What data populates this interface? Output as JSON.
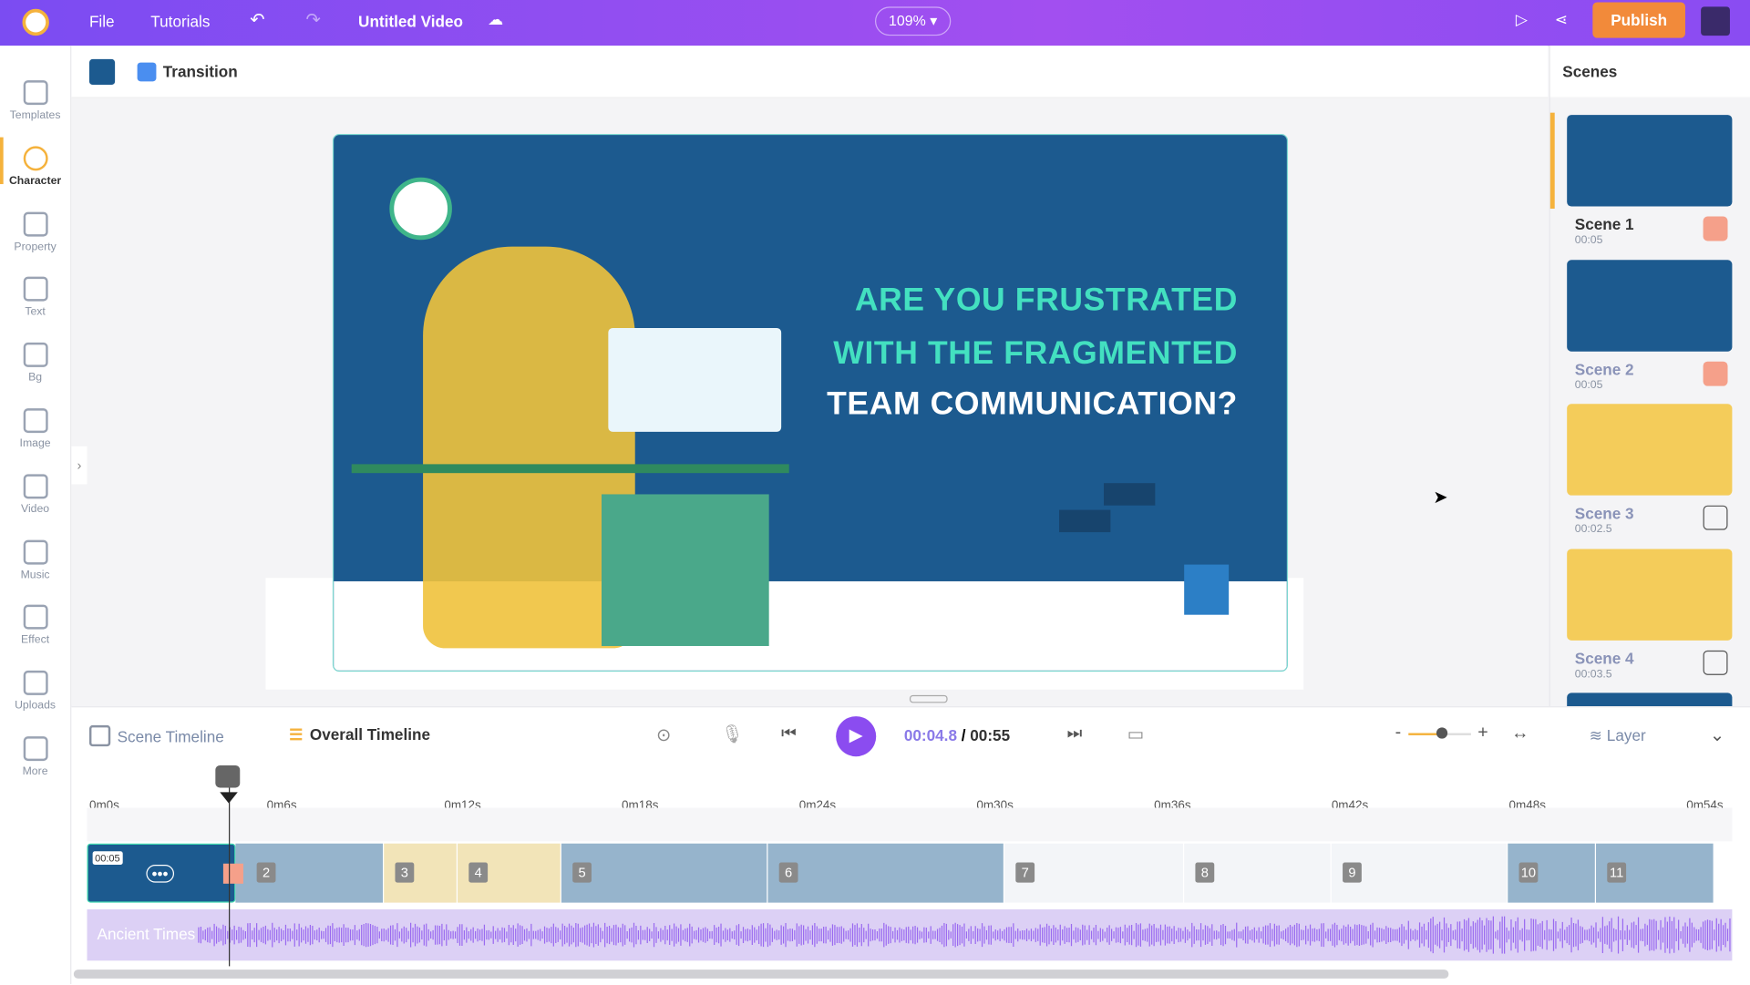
{
  "topbar": {
    "file": "File",
    "tutorials": "Tutorials",
    "title": "Untitled Video",
    "zoom": "109%",
    "publish": "Publish"
  },
  "sidebar": {
    "items": [
      {
        "label": "Templates"
      },
      {
        "label": "Character"
      },
      {
        "label": "Property"
      },
      {
        "label": "Text"
      },
      {
        "label": "Bg"
      },
      {
        "label": "Image"
      },
      {
        "label": "Video"
      },
      {
        "label": "Music"
      },
      {
        "label": "Effect"
      },
      {
        "label": "Uploads"
      },
      {
        "label": "More"
      }
    ],
    "active": "Character"
  },
  "subbar": {
    "transition": "Transition",
    "color": "#1c5a8f"
  },
  "slide": {
    "line1": "ARE YOU FRUSTRATED",
    "line2": "WITH THE FRAGMENTED",
    "line3": "TEAM COMMUNICATION?"
  },
  "scenes": {
    "title": "Scenes",
    "items": [
      {
        "name": "Scene 1",
        "dur": "00:05",
        "color": "#1c5a8f"
      },
      {
        "name": "Scene 2",
        "dur": "00:05",
        "color": "#1c5a8f"
      },
      {
        "name": "Scene 3",
        "dur": "00:02.5",
        "color": "#f4cc5a"
      },
      {
        "name": "Scene 4",
        "dur": "00:03.5",
        "color": "#f4cc5a"
      }
    ]
  },
  "timeline": {
    "scene_tab": "Scene Timeline",
    "overall_tab": "Overall Timeline",
    "current": "00:04.8",
    "sep": "/",
    "total": "00:55",
    "layer": "Layer",
    "ticks": [
      "0m0s",
      "0m6s",
      "0m12s",
      "0m18s",
      "0m24s",
      "0m30s",
      "0m36s",
      "0m42s",
      "0m48s",
      "0m54s"
    ],
    "first_block_label": "00:05",
    "blocks": [
      "2",
      "3",
      "4",
      "5",
      "6",
      "7",
      "8",
      "9",
      "10",
      "11"
    ],
    "audio": "Ancient Times"
  }
}
